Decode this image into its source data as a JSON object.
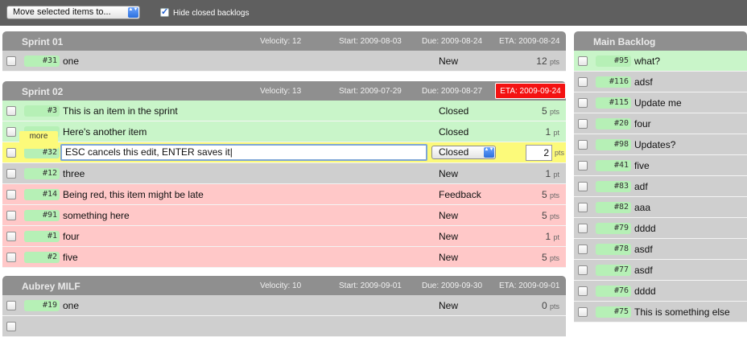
{
  "toolbar": {
    "move_select": "Move selected items to...",
    "hide_closed_label": "Hide closed backlogs",
    "arrows_glyph": "▲▼"
  },
  "sprints": [
    {
      "title": "Sprint 01",
      "velocity": "Velocity: 12",
      "start": "Start: 2009-08-03",
      "due": "Due: 2009-08-24",
      "eta": "ETA: 2009-08-24",
      "items": [
        {
          "num": "#31",
          "title": "one",
          "status": "New",
          "pts": "12",
          "unit": "pts"
        }
      ]
    },
    {
      "title": "Sprint 02",
      "velocity": "Velocity: 13",
      "start": "Start: 2009-07-29",
      "due": "Due: 2009-08-27",
      "eta": "ETA: 2009-09-24",
      "items": [
        {
          "num": "#3",
          "title": "This is an item in the sprint",
          "status": "Closed",
          "pts": "5",
          "unit": "pts"
        },
        {
          "num": "",
          "title": "Here's another item",
          "status": "Closed",
          "pts": "1",
          "unit": "pt"
        },
        {
          "num": "#32",
          "title": "ESC cancels this edit, ENTER saves it",
          "status": "Closed",
          "pts": "2",
          "unit": "pts"
        },
        {
          "num": "#12",
          "title": "three",
          "status": "New",
          "pts": "1",
          "unit": "pt"
        },
        {
          "num": "#14",
          "title": "Being red, this item might be late",
          "status": "Feedback",
          "pts": "5",
          "unit": "pts"
        },
        {
          "num": "#91",
          "title": "something here",
          "status": "New",
          "pts": "5",
          "unit": "pts"
        },
        {
          "num": "#1",
          "title": "four",
          "status": "New",
          "pts": "1",
          "unit": "pt"
        },
        {
          "num": "#2",
          "title": "five",
          "status": "New",
          "pts": "5",
          "unit": "pts"
        }
      ],
      "more_label": "more"
    },
    {
      "title": "Aubrey MILF",
      "velocity": "Velocity: 10",
      "start": "Start: 2009-09-01",
      "due": "Due: 2009-09-30",
      "eta": "ETA: 2009-09-01",
      "items": [
        {
          "num": "#19",
          "title": "one",
          "status": "New",
          "pts": "0",
          "unit": "pts"
        }
      ]
    }
  ],
  "main_backlog": {
    "title": "Main Backlog",
    "items": [
      {
        "num": "#95",
        "title": "what?"
      },
      {
        "num": "#116",
        "title": "adsf"
      },
      {
        "num": "#115",
        "title": "Update me"
      },
      {
        "num": "#20",
        "title": "four"
      },
      {
        "num": "#98",
        "title": "Updates?"
      },
      {
        "num": "#41",
        "title": "five"
      },
      {
        "num": "#83",
        "title": "adf"
      },
      {
        "num": "#82",
        "title": "aaa"
      },
      {
        "num": "#79",
        "title": "dddd"
      },
      {
        "num": "#78",
        "title": "asdf"
      },
      {
        "num": "#77",
        "title": "asdf"
      },
      {
        "num": "#76",
        "title": "dddd"
      },
      {
        "num": "#75",
        "title": "This is something else"
      }
    ]
  },
  "colors": {
    "toolbar": "#5f5f5f",
    "header": "#8f8f8f",
    "row_grey": "#cfcfcf",
    "row_green": "#c9f5c9",
    "row_red": "#ffc8c8",
    "row_edit": "#fcfa7a",
    "eta_late": "#f41212",
    "number_badge": "#b6f0b6"
  }
}
